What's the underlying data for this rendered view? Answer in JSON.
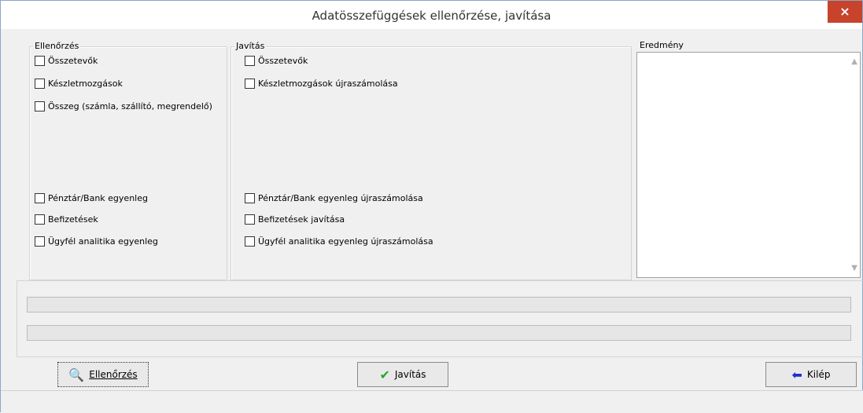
{
  "window": {
    "title": "Adatösszefüggések ellenőrzése, javítása",
    "close_label": "×"
  },
  "check_group": {
    "label": "Ellenőrzés",
    "items": [
      "Összetevők",
      "Készletmozgások",
      "Összeg (számla, szállító, megrendelő)",
      "Pénztár/Bank egyenleg",
      "Befizetések",
      "Ügyfél analitika egyenleg"
    ]
  },
  "fix_group": {
    "label": "Javítás",
    "items": [
      "Összetevők",
      "Készletmozgások újraszámolása",
      "Pénztár/Bank egyenleg újraszámolása",
      "Befizetések javítása",
      "Ügyfél analitika egyenleg újraszámolása"
    ]
  },
  "result_group": {
    "label": "Eredmény"
  },
  "buttons": {
    "check": "Ellenőrzés",
    "fix": "Javítás",
    "exit": "Kilép"
  }
}
